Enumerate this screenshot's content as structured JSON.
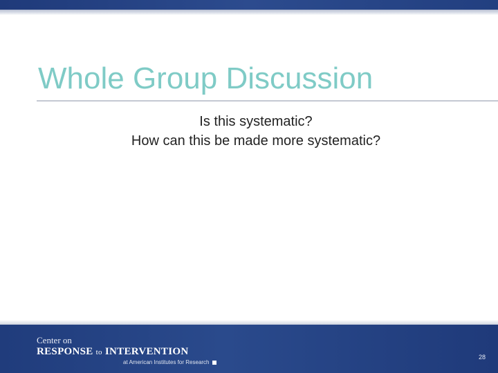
{
  "slide": {
    "title": "Whole Group Discussion",
    "body_lines": [
      "Is this systematic?",
      "How can this be made more systematic?"
    ],
    "page_number": "28"
  },
  "footer_logo": {
    "line1": "Center on",
    "line2_part1": "RESPONSE",
    "line2_part2": "to",
    "line2_part3": "INTERVENTION",
    "line3": "at American Institutes for Research"
  },
  "colors": {
    "title": "#7fcbc6",
    "band": "#24427f",
    "body_text": "#222222"
  }
}
